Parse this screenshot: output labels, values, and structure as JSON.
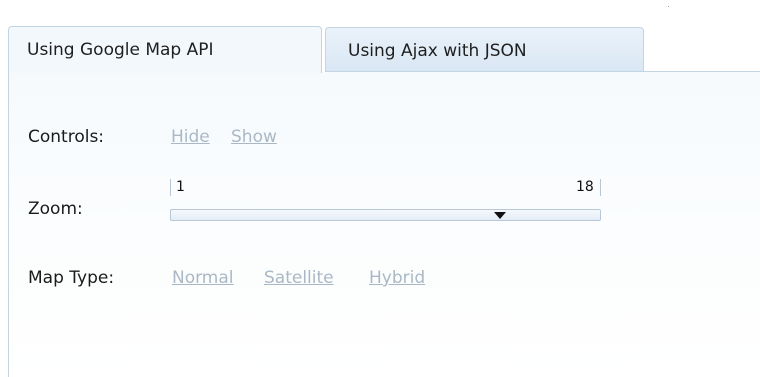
{
  "tabs": [
    {
      "label": "Using Google Map API",
      "active": true
    },
    {
      "label": "Using Ajax with JSON",
      "active": false
    }
  ],
  "controls": {
    "label": "Controls:",
    "hide_link": "Hide",
    "show_link": "Show"
  },
  "zoom": {
    "label": "Zoom:",
    "min_label": "1",
    "max_label": "18",
    "min": 1,
    "max": 18,
    "current_value": 14
  },
  "map_type": {
    "label": "Map Type:",
    "options": [
      "Normal",
      "Satellite",
      "Hybrid"
    ]
  },
  "colors": {
    "link": "#aab8c6",
    "tab_border": "#c3d4e3",
    "tab_inactive_bg": "#d9e7f4",
    "thumb": "#111111"
  }
}
